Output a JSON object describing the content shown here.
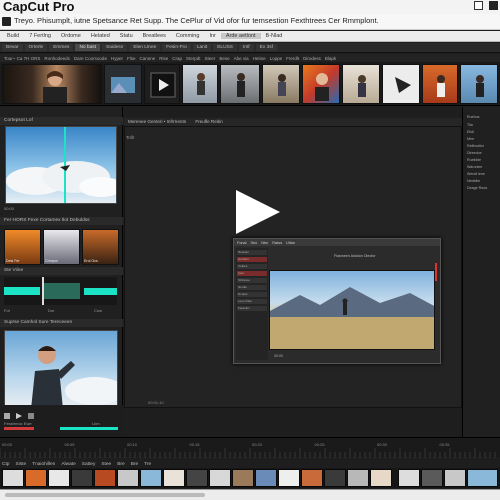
{
  "app": {
    "title": "CapCut Pro",
    "banner": "Treyo. Phisumplt, iutne Spetsance Ret Supp. The CePlur of Vid ofor fur temsestion Fexthtrees Cer Rmmplont."
  },
  "menubar": {
    "items": [
      "Build",
      "7 Fertlng",
      "Ordome",
      "Helated",
      "Statu",
      "Breatlees",
      "Comming",
      "Inr",
      "Arde aetlont",
      "B-Nlad"
    ]
  },
  "toolbar": {
    "items": [
      "Bevar",
      "Orterle",
      "Emmes",
      "No bast",
      "Saidesn",
      "Elen Ltnee",
      "Fesin-Fro",
      "Lanit",
      "ELUSS",
      "Intf",
      "Ex 3sf"
    ]
  },
  "media_header": {
    "items": [
      "Tour~ Ca 7H ORS",
      "Ronhodeeds",
      "Dare Coorsoode",
      "Hyper",
      "Flse",
      "Cannne",
      "Rise",
      "Crap",
      "Sterpdt",
      "Steer",
      "Bese",
      "Abe via",
      "Hetine",
      "Loppe",
      "Frerdlt",
      "Dirodess",
      "Blapk"
    ]
  },
  "left_panel": {
    "preview_header": "Cortepsot Lof",
    "preview_time": "00:00",
    "effects_header": "Fer HORS   Fexe   Cortamex tlot   Debuldss",
    "effects": [
      "Desl Fer",
      "Chmpor",
      "Erol Ocs"
    ],
    "wave_header": "Ste Viine",
    "wave_labels": [
      "Fot",
      "Dor",
      "Cow"
    ],
    "bottom_header": "Suprse   Camhol Sure Tereceeen",
    "controls_label": "Fesstrmoc Ewe",
    "controls_value": "Lkm"
  },
  "viewer": {
    "header": "Merenee Genteri  •  Infrrnents",
    "tab": "Freufle Reitin",
    "label": "Tollr",
    "timecode": "00:01:10"
  },
  "float_win": {
    "title_items": [
      "Fonal",
      "Seo",
      "Nbn",
      "Ratos",
      "Ultan"
    ],
    "side_items": [
      "Restiam",
      "Hevlttes",
      "Colttes",
      "Aanr",
      "Sinfanoe",
      "Nerdie",
      "Dnnplo",
      "Leoy Ftlas",
      "Faraeltin"
    ],
    "tools": "Flasmeen   Aidoton   Oleofor",
    "time": "00:00"
  },
  "right_panel": {
    "items": [
      "Ruehos",
      "Tlla",
      "Elldl",
      "Mee",
      "Relfimallor",
      "Dlreedoe",
      "Ruelidite",
      "Waronlee",
      "Wendl lene",
      "Nedeller",
      "Deage Rooa"
    ]
  },
  "timeline": {
    "tabs": [
      "Ctp",
      "Siste",
      "Tnaiohillen",
      "Alwate",
      "Sattey",
      "Stee",
      "Bre",
      "Bre",
      "Tre"
    ],
    "marks": [
      "00:00",
      "00:05",
      "00:10",
      "00:15",
      "00:20",
      "00:25",
      "00:30",
      "00:35"
    ]
  },
  "colors": {
    "accent_teal": "#1ce3c6",
    "accent_red": "#d33a3a",
    "panel_bg": "#202020"
  }
}
